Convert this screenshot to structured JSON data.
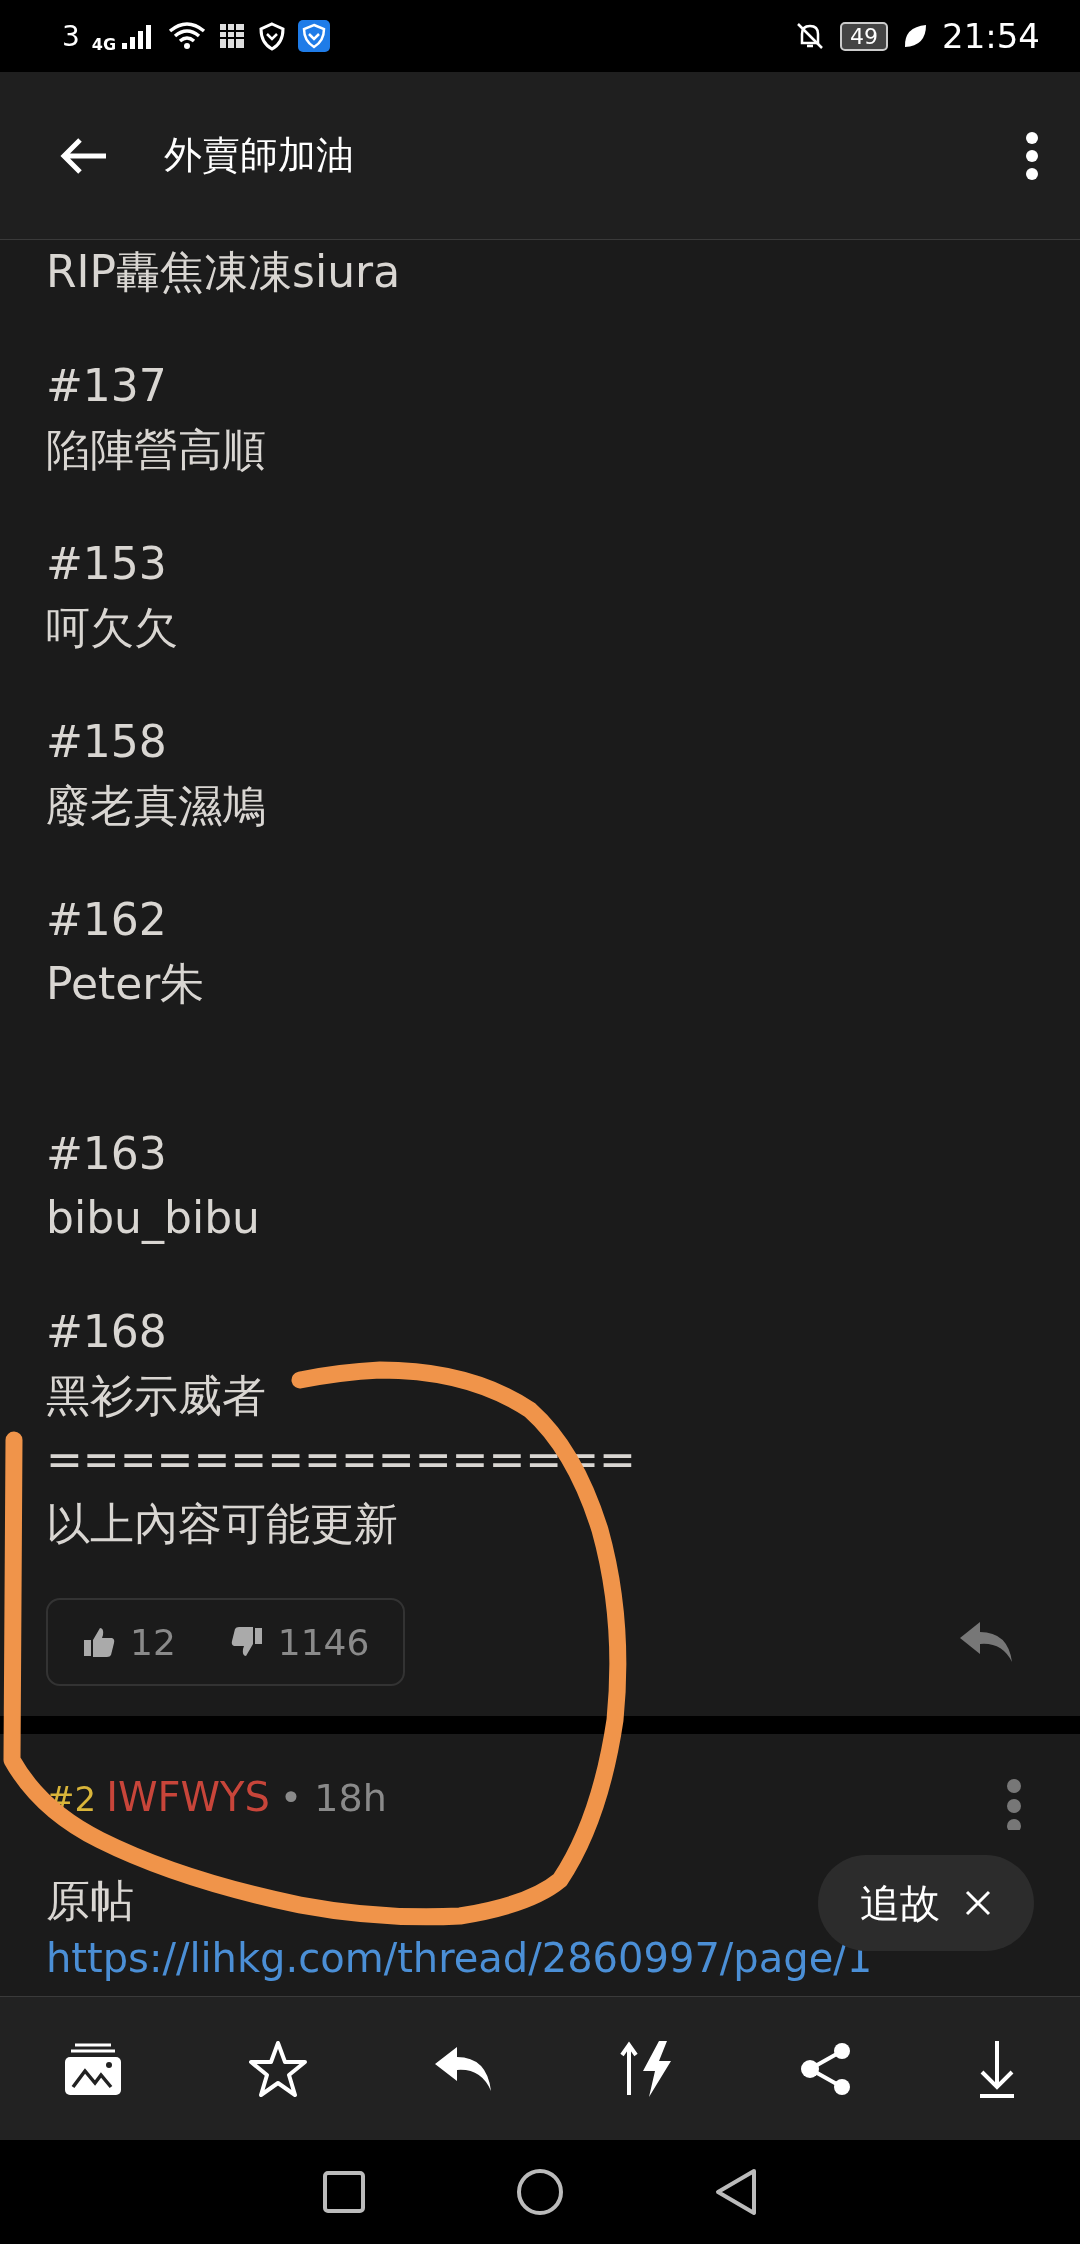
{
  "status_bar": {
    "sim": "3",
    "network": "4G",
    "battery": "49",
    "time": "21:54"
  },
  "app_bar": {
    "title": "外賣師加油"
  },
  "post": {
    "lines": [
      {
        "kind": "text",
        "text": "RIP轟焦凍凍siura"
      },
      {
        "kind": "entry",
        "number": "#137",
        "name": "陷陣營高順"
      },
      {
        "kind": "entry",
        "number": "#153",
        "name": "呵欠欠"
      },
      {
        "kind": "entry",
        "number": "#158",
        "name": "廢老真濕鳩"
      },
      {
        "kind": "entry",
        "number": "#162",
        "name": "Peter朱"
      },
      {
        "kind": "blank"
      },
      {
        "kind": "entry",
        "number": "#163",
        "name": "bibu_bibu"
      },
      {
        "kind": "entry",
        "number": "#168",
        "name": "黑衫示威者"
      },
      {
        "kind": "text",
        "text": "================"
      },
      {
        "kind": "text",
        "text": "以上內容可能更新"
      }
    ],
    "likes": "12",
    "dislikes": "1146"
  },
  "reply": {
    "number": "#2",
    "author": "IWFWYS",
    "age": "• 18h",
    "body": "原帖",
    "link": "https://lihkg.com/thread/2860997/page/1"
  },
  "chip": {
    "label": "追故"
  }
}
